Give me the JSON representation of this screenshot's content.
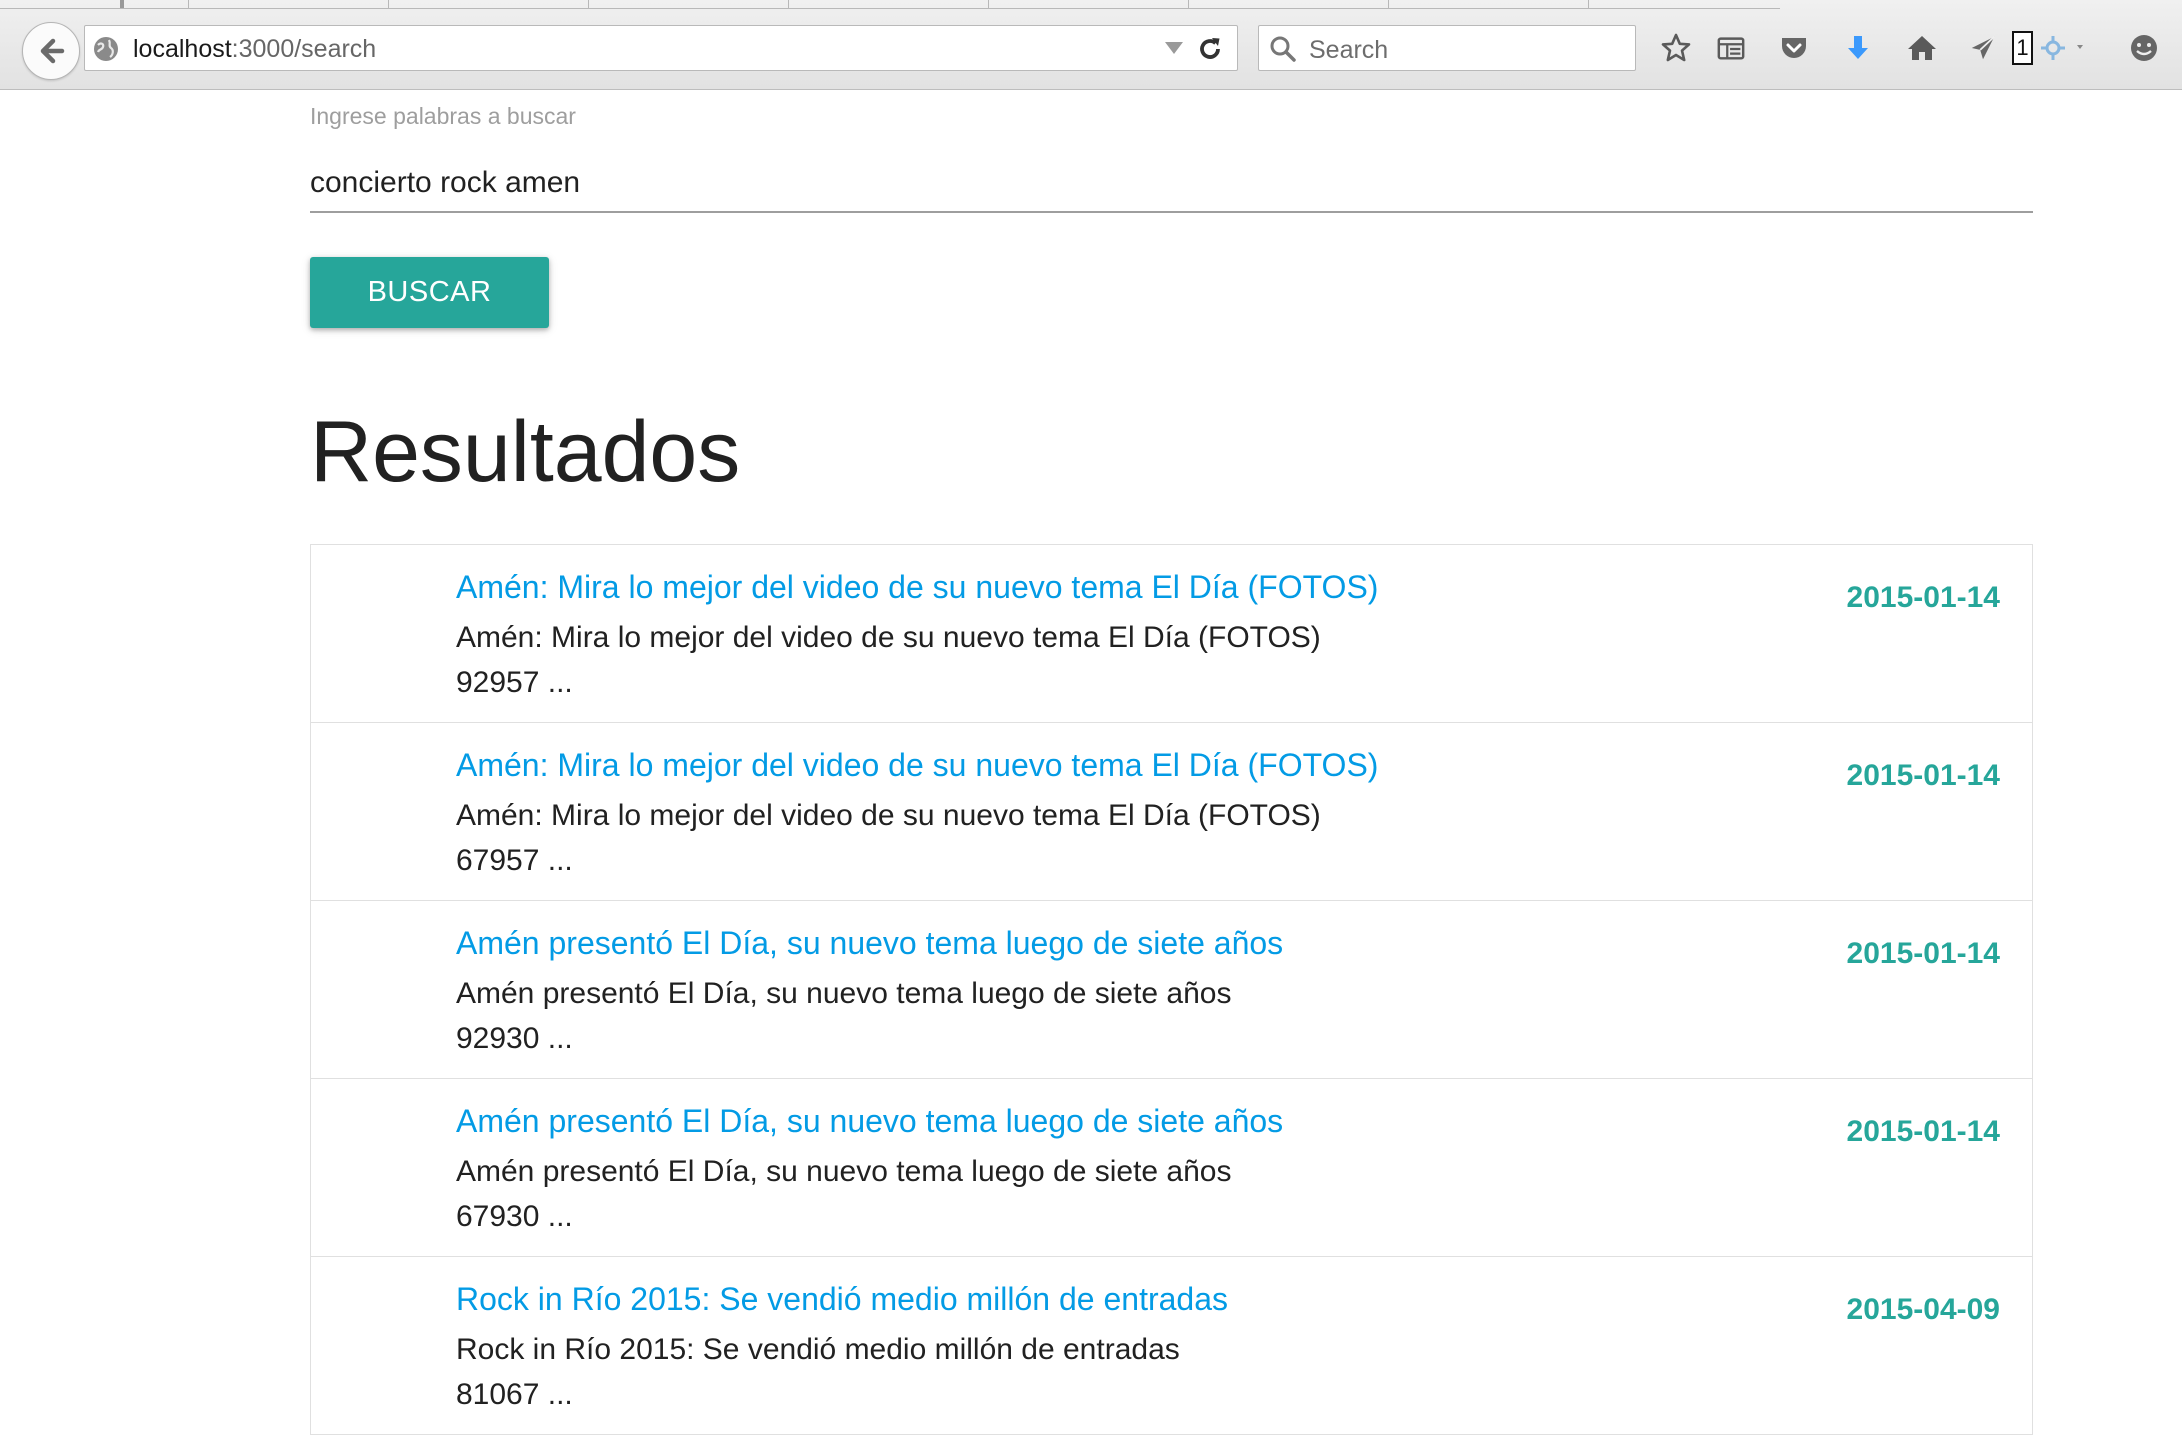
{
  "browser": {
    "url_host": "localhost",
    "url_path": ":3000/search",
    "search_placeholder": "Search",
    "download_color": "#3b99fc",
    "badge_count": "1"
  },
  "search": {
    "label": "Ingrese palabras a buscar",
    "value": "concierto rock amen",
    "button_label": "BUSCAR"
  },
  "results": {
    "heading": "Resultados",
    "items": [
      {
        "title": "Amén: Mira lo mejor del video de su nuevo tema El Día (FOTOS)",
        "snippet": "Amén: Mira lo mejor del video de su nuevo tema El Día (FOTOS)",
        "id": "92957 ...",
        "date": "2015-01-14"
      },
      {
        "title": "Amén: Mira lo mejor del video de su nuevo tema El Día (FOTOS)",
        "snippet": "Amén: Mira lo mejor del video de su nuevo tema El Día (FOTOS)",
        "id": "67957 ...",
        "date": "2015-01-14"
      },
      {
        "title": "Amén presentó El Día, su nuevo tema luego de siete años",
        "snippet": "Amén presentó El Día, su nuevo tema luego de siete años",
        "id": "92930 ...",
        "date": "2015-01-14"
      },
      {
        "title": "Amén presentó El Día, su nuevo tema luego de siete años",
        "snippet": "Amén presentó El Día, su nuevo tema luego de siete años",
        "id": "67930 ...",
        "date": "2015-01-14"
      },
      {
        "title": "Rock in Río 2015: Se vendió medio millón de entradas",
        "snippet": "Rock in Río 2015: Se vendió medio millón de entradas",
        "id": "81067 ...",
        "date": "2015-04-09"
      }
    ]
  },
  "colors": {
    "accent": "#26a69a",
    "link": "#039be5"
  }
}
